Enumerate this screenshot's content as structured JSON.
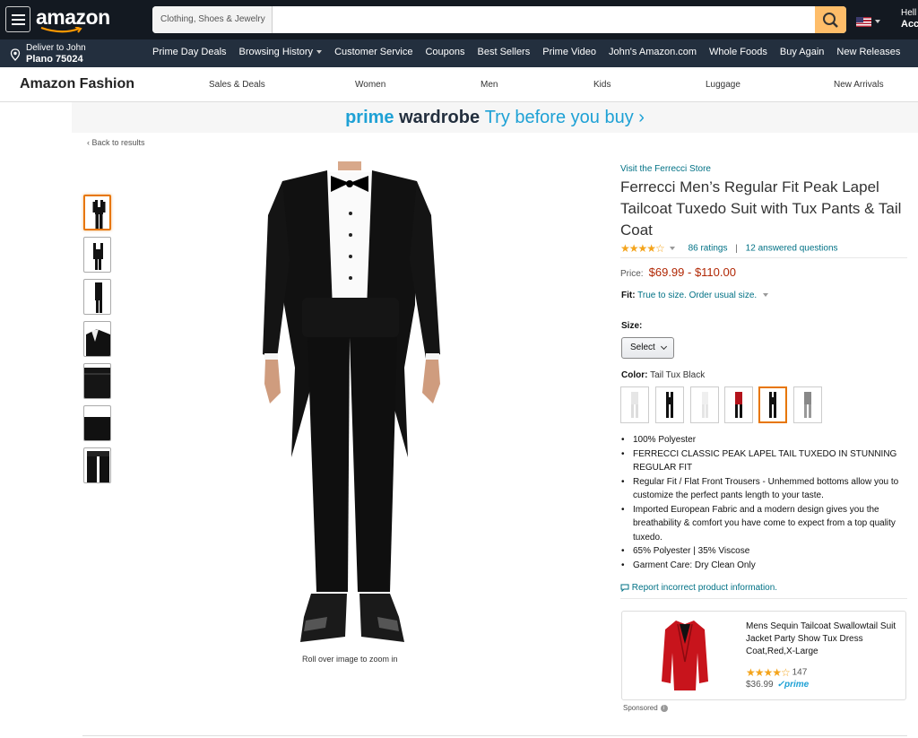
{
  "header": {
    "logo": "amazon",
    "search": {
      "category": "Clothing, Shoes & Jewelry",
      "placeholder": "",
      "button_icon": "search-icon"
    },
    "account_line1": "Hell",
    "account_line2": "Acc"
  },
  "subnav": {
    "deliver_line1": "Deliver to John",
    "deliver_line2": "Plano 75024",
    "links": [
      "Prime Day Deals",
      "Browsing History",
      "Customer Service",
      "Coupons",
      "Best Sellers",
      "Prime Video",
      "John's Amazon.com",
      "Whole Foods",
      "Buy Again",
      "New Releases"
    ]
  },
  "fashion": {
    "title": "Amazon Fashion",
    "links": [
      "Sales & Deals",
      "Women",
      "Men",
      "Kids",
      "Luggage",
      "New Arrivals"
    ]
  },
  "banner": {
    "part1": "prime",
    "part2": "wardrobe",
    "part3": "Try before you buy",
    "arrow": "›"
  },
  "back_link": "‹ Back to results",
  "zoom_hint": "Roll over image to zoom in",
  "product": {
    "store_link": "Visit the Ferrecci Store",
    "title": "Ferrecci Men’s Regular Fit Peak Lapel Tailcoat Tuxedo Suit with Tux Pants & Tail Coat",
    "stars": "★★★★☆",
    "rating_value": 4.5,
    "ratings_count": "86 ratings",
    "sep": "|",
    "answered": "12 answered questions",
    "price_label": "Price:",
    "price": "$69.99 - $110.00",
    "fit_label": "Fit:",
    "fit_value": "True to size. Order usual size.",
    "size_label": "Size:",
    "size_select": "Select",
    "color_label": "Color:",
    "color_value": "Tail Tux Black",
    "bullets": [
      "100% Polyester",
      "FERRECCI CLASSIC PEAK LAPEL TAIL TUXEDO IN STUNNING REGULAR FIT",
      "Regular Fit / Flat Front Trousers - Unhemmed bottoms allow you to customize the perfect pants length to your taste.",
      "Imported European Fabric and a modern design gives you the breathability & comfort you have come to expect from a top quality tuxedo.",
      "65% Polyester | 35% Viscose",
      "Garment Care: Dry Clean Only"
    ],
    "report": "Report incorrect product information."
  },
  "sponsored": {
    "title": "Mens Sequin Tailcoat Swallowtail Suit Jacket Party Show Tux Dress Coat,Red,X-Large",
    "stars": "★★★★☆",
    "count": "147",
    "price": "$36.99",
    "prime": "prime",
    "label": "Sponsored"
  },
  "colors": {
    "nav_dark": "#131921",
    "nav_sub": "#232f3e",
    "search_btn": "#febd69",
    "link": "#007185",
    "price": "#b12704",
    "accent": "#e77600",
    "prime_blue": "#1ea1d5",
    "star": "#f4a41c"
  }
}
